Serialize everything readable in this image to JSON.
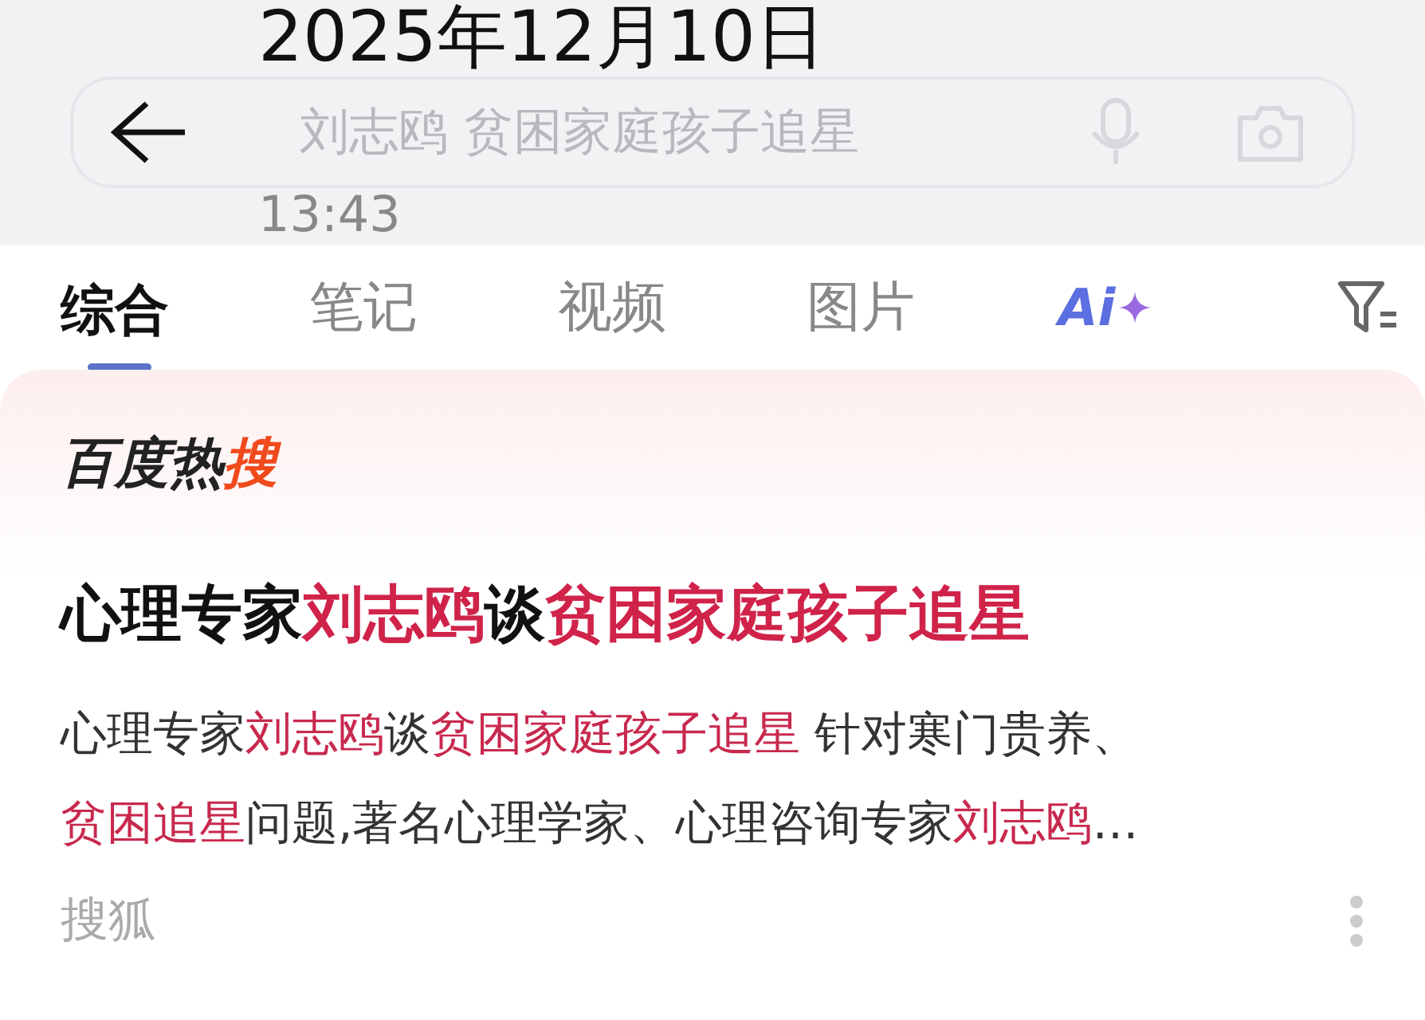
{
  "search": {
    "query": "刘志鸥 贫困家庭孩子追星"
  },
  "overlay": {
    "date": "2025年12月10日",
    "time": "13:43"
  },
  "tabs": [
    {
      "label": "综合",
      "selected": true
    },
    {
      "label": "笔记",
      "selected": false
    },
    {
      "label": "视频",
      "selected": false
    },
    {
      "label": "图片",
      "selected": false
    },
    {
      "label": "Ai",
      "selected": false
    }
  ],
  "card": {
    "logo": [
      {
        "text": "百度热",
        "highlight": false
      },
      {
        "text": "搜",
        "highlight": true
      }
    ],
    "title": [
      {
        "text": "心理专家",
        "highlight": false
      },
      {
        "text": "刘志鸥",
        "highlight": true
      },
      {
        "text": "谈",
        "highlight": false
      },
      {
        "text": "贫困家庭孩子追星",
        "highlight": true
      }
    ],
    "body_lines": [
      [
        {
          "text": "心理专家",
          "highlight": false
        },
        {
          "text": "刘志鸥",
          "highlight": true
        },
        {
          "text": "谈",
          "highlight": false
        },
        {
          "text": "贫困家庭孩子追星",
          "highlight": true
        },
        {
          "text": " 针对寒门贵养、",
          "highlight": false
        }
      ],
      [
        {
          "text": "贫困追星",
          "highlight": true
        },
        {
          "text": "问题,著名心理学家、心理咨询专家",
          "highlight": false
        },
        {
          "text": "刘志鸥",
          "highlight": true
        },
        {
          "text": "…",
          "highlight": false
        }
      ]
    ],
    "source": "搜狐"
  }
}
